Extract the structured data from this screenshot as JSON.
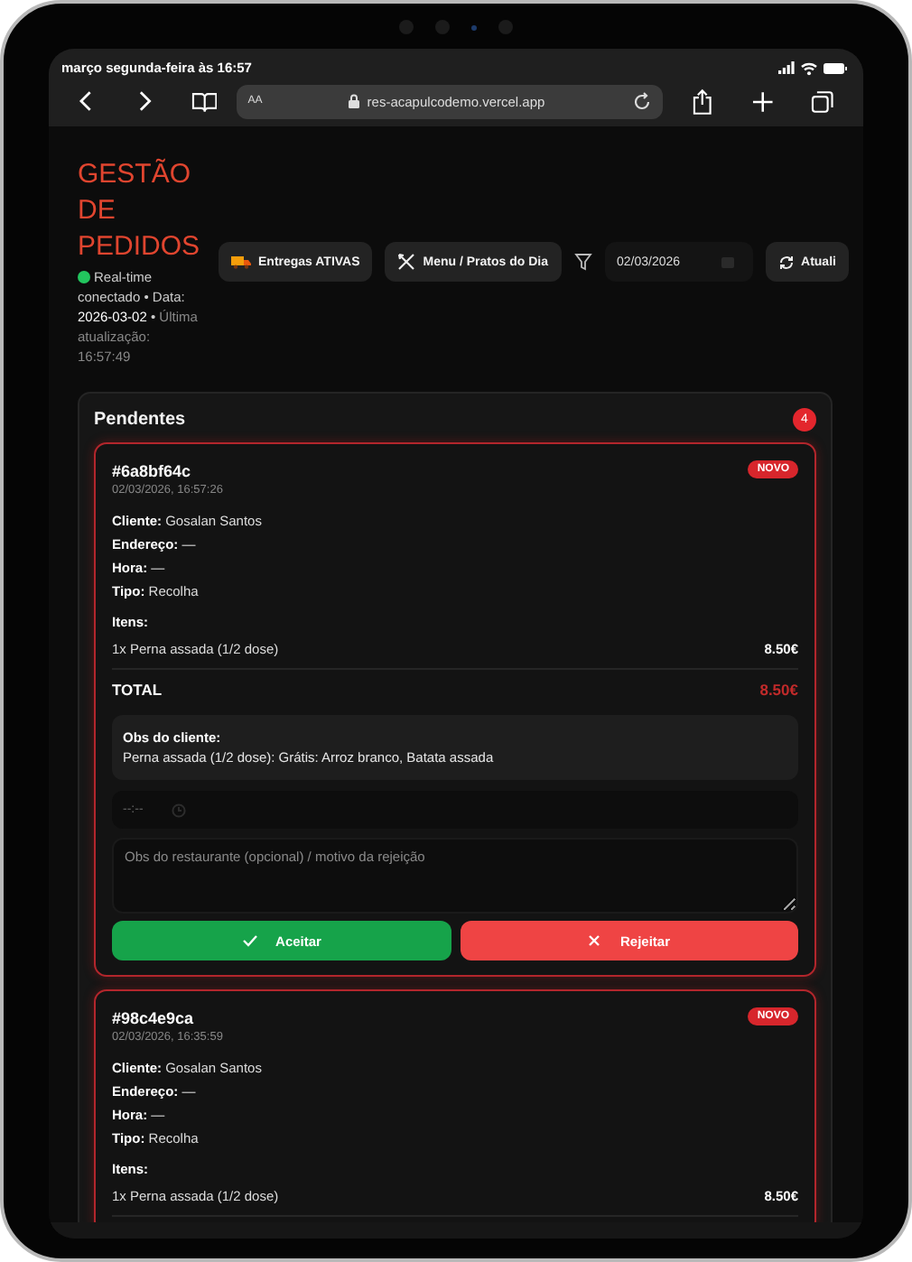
{
  "status_bar": {
    "time": "março segunda-feira às 16:57"
  },
  "browser": {
    "text_size": "AA",
    "url": "res-acapulcodemo.vercel.app"
  },
  "header": {
    "title": "GESTÃO DE PEDIDOS",
    "connection": {
      "online": true,
      "text": "Real-time conectado • Data: **2026-03-02** • *Última atualização: 16:57:49*"
    },
    "buttons": [
      {
        "label": "Entregas ATIVAS",
        "kind": "truck"
      },
      {
        "label": "Menu / Pratos do Dia",
        "kind": "utensils"
      }
    ],
    "date_filter": {
      "value": "02/03/2026"
    },
    "refresh": {
      "label": "Atuali"
    }
  },
  "pending": {
    "title": "Pendentes",
    "count": "4",
    "orders": [
      {
        "id": "#6a8bf64c",
        "datetime": "02/03/2026, 16:57:26",
        "badge": "NOVO",
        "fields": [
          "**Cliente:** Gosalan Santos",
          "**Endereço:** —",
          "**Hora:** —",
          "**Tipo:** Recolha"
        ],
        "items_label": "Itens:",
        "items": [
          {
            "name": "1x Perna assada (1/2 dose)",
            "price": "8.50€"
          }
        ],
        "total_label": "TOTAL",
        "total": "8.50€",
        "obs_label": "Obs do cliente:",
        "obs": "Perna assada (1/2 dose): Grátis: Arroz branco, Batata assada",
        "time_placeholder": "--:--",
        "notes_placeholder": "Obs do restaurante (opcional) / motivo da rejeição",
        "actions": [
          {
            "label": "Aceitar",
            "kind": "accept"
          },
          {
            "label": "Rejeitar",
            "kind": "reject"
          }
        ]
      },
      {
        "id": "#98c4e9ca",
        "datetime": "02/03/2026, 16:35:59",
        "badge": "NOVO",
        "fields": [
          "**Cliente:** Gosalan Santos",
          "**Endereço:** —",
          "**Hora:** —",
          "**Tipo:** Recolha"
        ],
        "items_label": "Itens:",
        "items": [
          {
            "name": "1x Perna assada (1/2 dose)",
            "price": "8.50€"
          }
        ]
      }
    ]
  }
}
